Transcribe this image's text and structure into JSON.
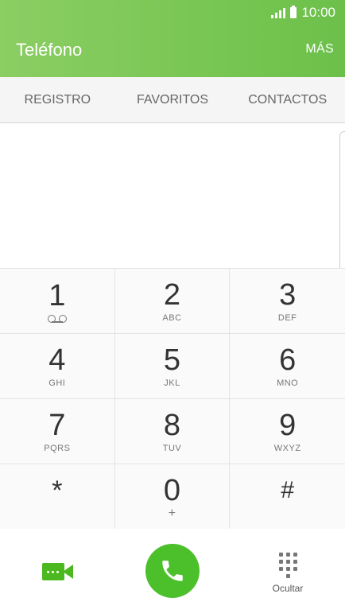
{
  "status": {
    "time": "10:00"
  },
  "header": {
    "title": "Teléfono",
    "more": "MÁS"
  },
  "tabs": [
    {
      "label": "REGISTRO"
    },
    {
      "label": "FAVORITOS"
    },
    {
      "label": "CONTACTOS"
    }
  ],
  "keypad": [
    {
      "digit": "1",
      "sub": ""
    },
    {
      "digit": "2",
      "sub": "ABC"
    },
    {
      "digit": "3",
      "sub": "DEF"
    },
    {
      "digit": "4",
      "sub": "GHI"
    },
    {
      "digit": "5",
      "sub": "JKL"
    },
    {
      "digit": "6",
      "sub": "MNO"
    },
    {
      "digit": "7",
      "sub": "PQRS"
    },
    {
      "digit": "8",
      "sub": "TUV"
    },
    {
      "digit": "9",
      "sub": "WXYZ"
    },
    {
      "digit": "*",
      "sub": ""
    },
    {
      "digit": "0",
      "sub": "+"
    },
    {
      "digit": "#",
      "sub": ""
    }
  ],
  "bottom": {
    "hide_label": "Ocultar"
  },
  "icons": {
    "signal": "signal-icon",
    "battery": "battery-icon",
    "voicemail": "voicemail-icon",
    "video_call": "video-call-icon",
    "call": "phone-icon",
    "keypad": "keypad-icon"
  },
  "colors": {
    "accent": "#6cc04a",
    "call": "#4cc02a"
  }
}
